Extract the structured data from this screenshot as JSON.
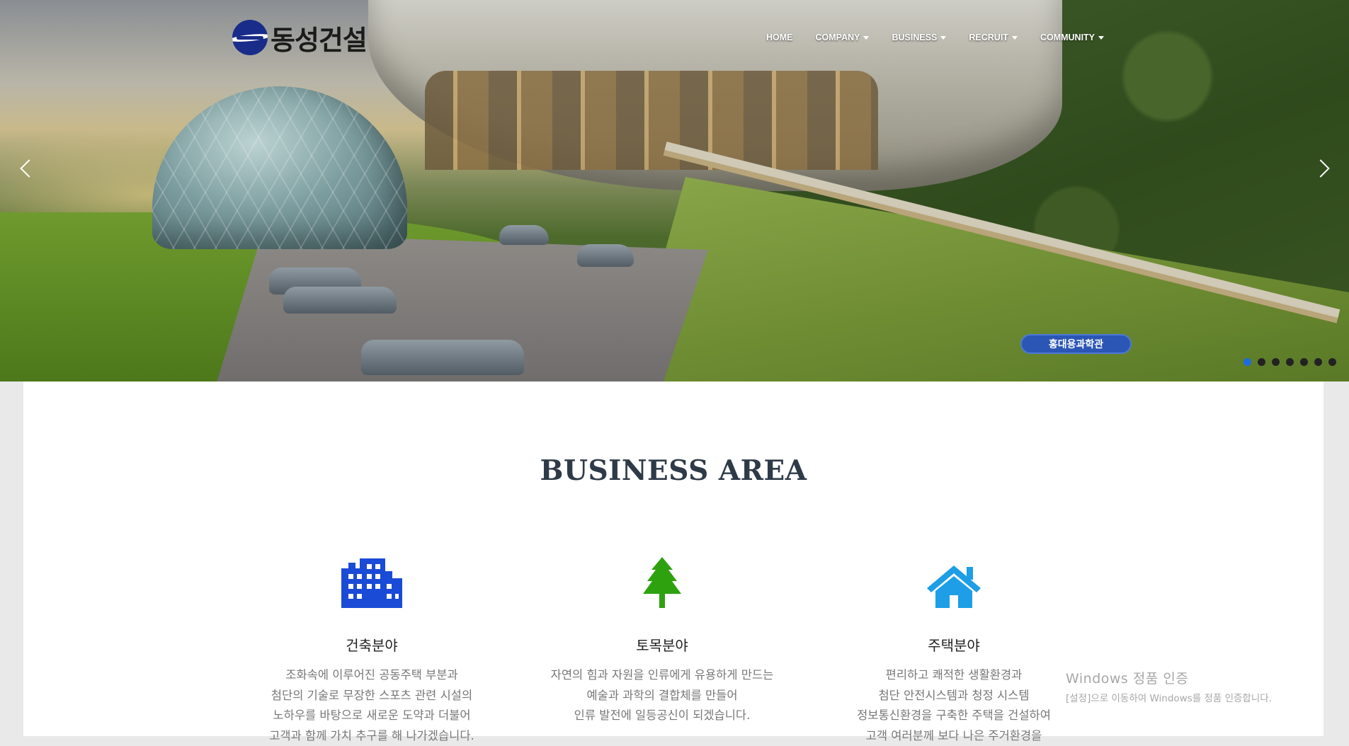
{
  "brand": {
    "logo_text": "동성건설",
    "logo_color": "#1a2c8a"
  },
  "nav": {
    "items": [
      {
        "label": "HOME",
        "dropdown": false
      },
      {
        "label": "COMPANY",
        "dropdown": true
      },
      {
        "label": "BUSINESS",
        "dropdown": true
      },
      {
        "label": "RECRUIT",
        "dropdown": true
      },
      {
        "label": "COMMUNITY",
        "dropdown": true
      }
    ]
  },
  "hero": {
    "caption": "홍대용과학관",
    "slide_count": 7,
    "active_slide": 1
  },
  "business": {
    "title": "BUSINESS AREA",
    "areas": [
      {
        "icon": "building-icon",
        "icon_color": "#1a4bd6",
        "title": "건축분야",
        "lines": [
          "조화속에 이루어진 공동주택 부분과",
          "첨단의 기술로 무장한 스포츠 관련 시설의",
          "노하우를 바탕으로 새로운 도약과 더불어",
          "고객과 함께 가치 추구를 해 나가겠습니다."
        ]
      },
      {
        "icon": "tree-icon",
        "icon_color": "#2ea10f",
        "title": "토목분야",
        "lines": [
          "자연의 힘과 자원을 인류에게 유용하게 만드는",
          "예술과 과학의 결합체를 만들어",
          "인류 발전에 일등공신이 되겠습니다."
        ]
      },
      {
        "icon": "home-icon",
        "icon_color": "#1d9ee6",
        "title": "주택분야",
        "lines": [
          "편리하고 쾌적한 생활환경과",
          "첨단 안전시스템과 청정 시스템",
          "정보통신환경을 구축한 주택을 건설하여",
          "고객 여러분께 보다 나은 주거환경을"
        ]
      }
    ]
  },
  "watermark": {
    "title": "Windows 정품 인증",
    "subtitle": "[설정]으로 이동하여 Windows를 정품 인증합니다."
  }
}
